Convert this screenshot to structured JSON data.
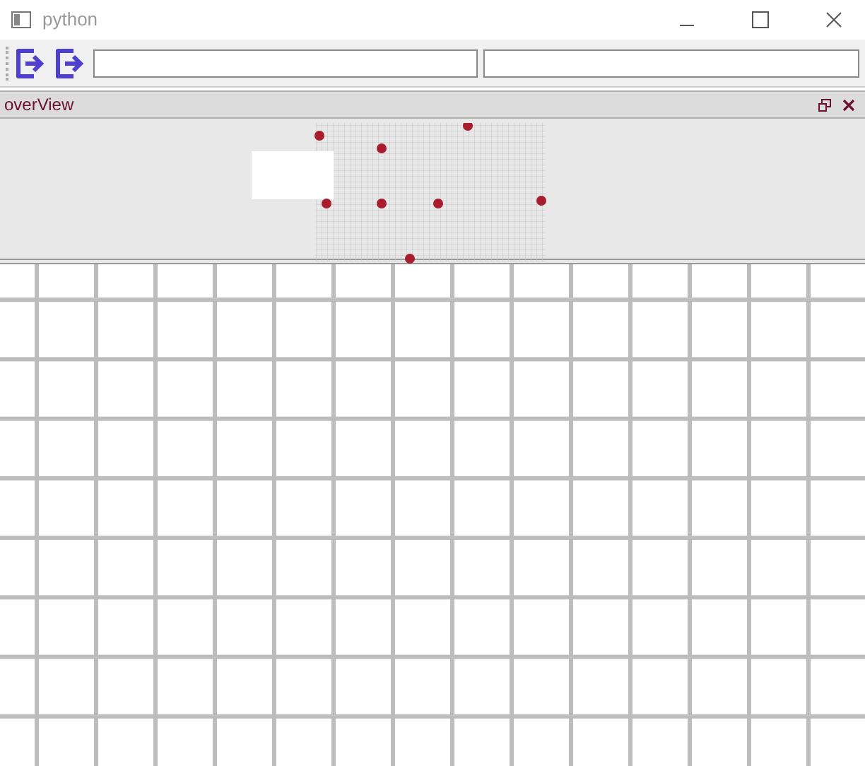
{
  "window": {
    "title": "python"
  },
  "dock": {
    "title": "overView"
  }
}
